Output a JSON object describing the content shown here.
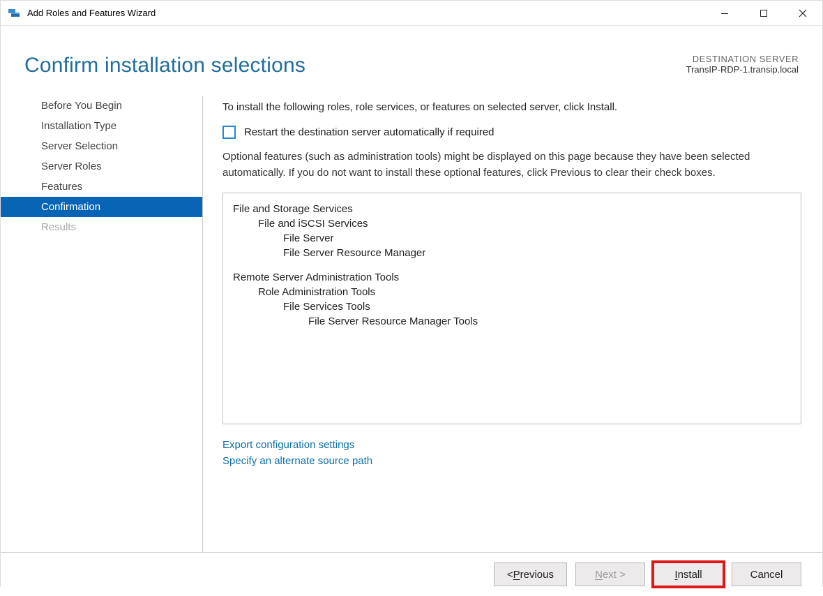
{
  "window": {
    "title": "Add Roles and Features Wizard"
  },
  "header": {
    "title": "Confirm installation selections",
    "dest_label": "DESTINATION SERVER",
    "dest_server": "TransIP-RDP-1.transip.local"
  },
  "sidebar": {
    "items": [
      {
        "label": "Before You Begin",
        "state": ""
      },
      {
        "label": "Installation Type",
        "state": ""
      },
      {
        "label": "Server Selection",
        "state": ""
      },
      {
        "label": "Server Roles",
        "state": ""
      },
      {
        "label": "Features",
        "state": ""
      },
      {
        "label": "Confirmation",
        "state": "active"
      },
      {
        "label": "Results",
        "state": "disabled"
      }
    ]
  },
  "main": {
    "intro": "To install the following roles, role services, or features on selected server, click Install.",
    "restart_label": "Restart the destination server automatically if required",
    "note": "Optional features (such as administration tools) might be displayed on this page because they have been selected automatically. If you do not want to install these optional features, click Previous to clear their check boxes.",
    "selections": {
      "group1": {
        "l0": "File and Storage Services",
        "l1": "File and iSCSI Services",
        "l2a": "File Server",
        "l2b": "File Server Resource Manager"
      },
      "group2": {
        "l0": "Remote Server Administration Tools",
        "l1": "Role Administration Tools",
        "l2": "File Services Tools",
        "l3": "File Server Resource Manager Tools"
      }
    },
    "links": {
      "export": "Export configuration settings",
      "altpath": "Specify an alternate source path"
    }
  },
  "footer": {
    "prev_prefix": "< ",
    "prev_u": "P",
    "prev_rest": "revious",
    "next_u": "N",
    "next_rest": "ext >",
    "install_u": "I",
    "install_rest": "nstall",
    "cancel": "Cancel"
  }
}
